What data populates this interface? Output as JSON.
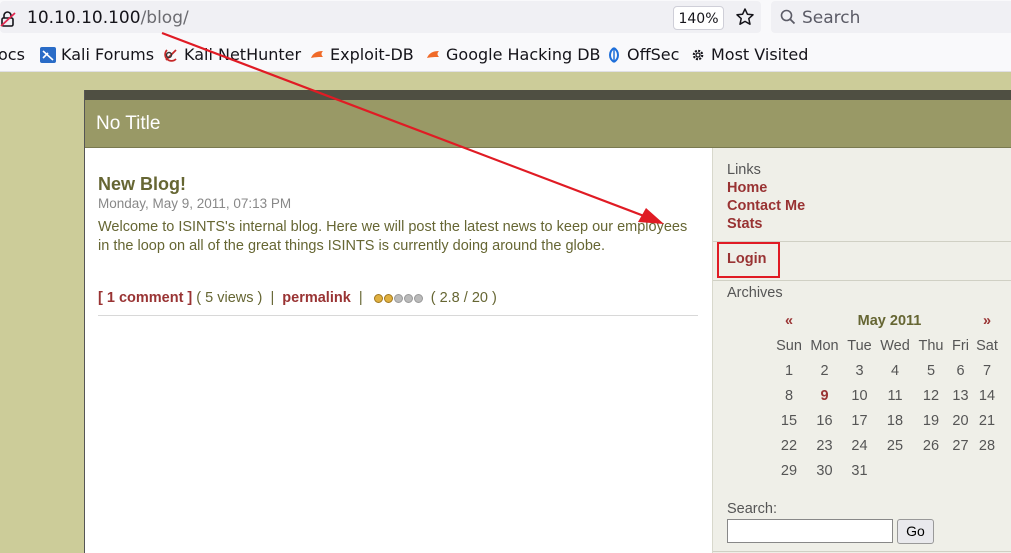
{
  "browser": {
    "url_host": "10.10.10.100",
    "url_path": "/blog/",
    "zoom": "140%",
    "search_placeholder": "Search"
  },
  "bookmarks": [
    {
      "label": "ocs"
    },
    {
      "label": "Kali Forums"
    },
    {
      "label": "Kali NetHunter"
    },
    {
      "label": "Exploit-DB"
    },
    {
      "label": "Google Hacking DB"
    },
    {
      "label": "OffSec"
    },
    {
      "label": "Most Visited"
    }
  ],
  "site": {
    "title": "No Title"
  },
  "post": {
    "title": "New Blog!",
    "date": "Monday, May 9, 2011, 07:13 PM",
    "body": "Welcome to ISINTS's internal blog. Here we will post the latest news to keep our employees in the loop on all of the great things ISINTS is currently doing around the globe.",
    "comments": "[ 1 comment ]",
    "views": "( 5 views )",
    "separator": "|",
    "permalink": "permalink",
    "rating_text": "( 2.8 / 20 )",
    "rating_stars_filled": 2,
    "rating_stars_total": 5
  },
  "sidebar": {
    "links_heading": "Links",
    "links": [
      "Home",
      "Contact Me",
      "Stats"
    ],
    "login": "Login",
    "archives_heading": "Archives",
    "calendar": {
      "prev": "«",
      "month": "May 2011",
      "next": "»",
      "dow": [
        "Sun",
        "Mon",
        "Tue",
        "Wed",
        "Thu",
        "Fri",
        "Sat"
      ],
      "weeks": [
        [
          "1",
          "2",
          "3",
          "4",
          "5",
          "6",
          "7"
        ],
        [
          "8",
          "9",
          "10",
          "11",
          "12",
          "13",
          "14"
        ],
        [
          "15",
          "16",
          "17",
          "18",
          "19",
          "20",
          "21"
        ],
        [
          "22",
          "23",
          "24",
          "25",
          "26",
          "27",
          "28"
        ],
        [
          "29",
          "30",
          "31",
          "",
          "",
          "",
          ""
        ]
      ],
      "highlight": "9"
    },
    "search_label": "Search:",
    "go_label": "Go"
  },
  "colors": {
    "page_bg": "#cccc99",
    "header_bg": "#999966",
    "link": "#993333",
    "annotation": "#e01b24"
  }
}
